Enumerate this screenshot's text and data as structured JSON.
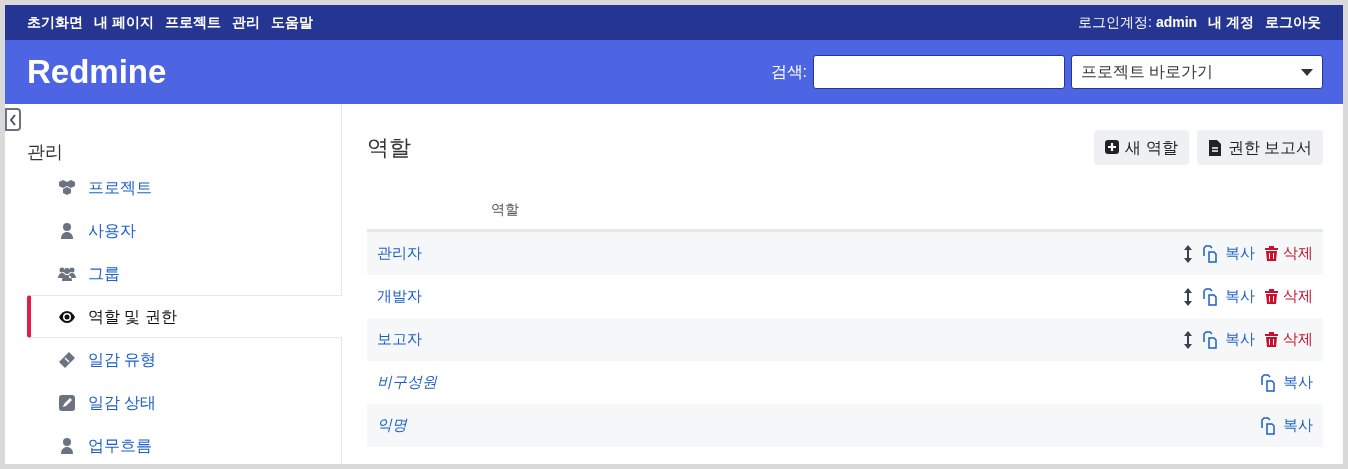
{
  "top_menu": [
    {
      "label": "초기화면"
    },
    {
      "label": "내 페이지"
    },
    {
      "label": "프로젝트"
    },
    {
      "label": "관리"
    },
    {
      "label": "도움말"
    }
  ],
  "account": {
    "logged_in_label": "로그인계정:",
    "user": "admin",
    "links": [
      "내 계정",
      "로그아웃"
    ]
  },
  "header": {
    "title": "Redmine",
    "search_label": "검색:",
    "project_jump": "프로젝트 바로가기"
  },
  "sidebar": {
    "title": "관리",
    "items": [
      {
        "kind": "projects",
        "label": "프로젝트",
        "selected": false
      },
      {
        "kind": "users",
        "label": "사용자",
        "selected": false
      },
      {
        "kind": "groups",
        "label": "그룹",
        "selected": false
      },
      {
        "kind": "roles",
        "label": "역할 및 권한",
        "selected": true
      },
      {
        "kind": "trackers",
        "label": "일감 유형",
        "selected": false
      },
      {
        "kind": "statuses",
        "label": "일감 상태",
        "selected": false
      },
      {
        "kind": "workflow",
        "label": "업무흐름",
        "selected": false
      }
    ]
  },
  "page": {
    "title": "역할",
    "buttons": [
      {
        "kind": "add",
        "label": "새 역할"
      },
      {
        "kind": "report",
        "label": "권한 보고서"
      }
    ]
  },
  "table": {
    "columns": [
      "역할"
    ],
    "rows": [
      {
        "name": "관리자",
        "builtin": false,
        "actions": [
          {
            "kind": "sort"
          },
          {
            "kind": "copy",
            "label": "복사"
          },
          {
            "kind": "delete",
            "label": "삭제"
          }
        ]
      },
      {
        "name": "개발자",
        "builtin": false,
        "actions": [
          {
            "kind": "sort"
          },
          {
            "kind": "copy",
            "label": "복사"
          },
          {
            "kind": "delete",
            "label": "삭제"
          }
        ]
      },
      {
        "name": "보고자",
        "builtin": false,
        "actions": [
          {
            "kind": "sort"
          },
          {
            "kind": "copy",
            "label": "복사"
          },
          {
            "kind": "delete",
            "label": "삭제"
          }
        ]
      },
      {
        "name": "비구성원",
        "builtin": true,
        "actions": [
          {
            "kind": "copy",
            "label": "복사"
          }
        ]
      },
      {
        "name": "익명",
        "builtin": true,
        "actions": [
          {
            "kind": "copy",
            "label": "복사"
          }
        ]
      }
    ]
  }
}
